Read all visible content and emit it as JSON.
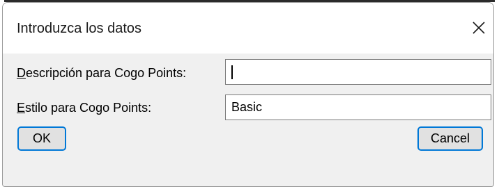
{
  "dialog": {
    "title": "Introduzca los datos",
    "close_icon": "close-icon"
  },
  "fields": {
    "description": {
      "label_accel": "D",
      "label_rest": "escripción para Cogo Points:",
      "value": ""
    },
    "style": {
      "label_accel": "E",
      "label_rest": "stilo para Cogo Points:",
      "value": "Basic"
    }
  },
  "buttons": {
    "ok_label": "OK",
    "cancel_label": "Cancel"
  },
  "colors": {
    "accent": "#0078d7",
    "client_bg": "#f0f0f0"
  }
}
